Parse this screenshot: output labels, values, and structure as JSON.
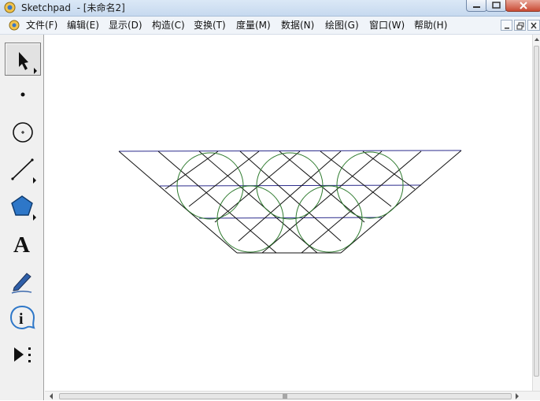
{
  "window": {
    "title": "Sketchpad  - [未命名2]"
  },
  "menu": {
    "items": [
      {
        "label": "文件(F)"
      },
      {
        "label": "编辑(E)"
      },
      {
        "label": "显示(D)"
      },
      {
        "label": "构造(C)"
      },
      {
        "label": "变换(T)"
      },
      {
        "label": "度量(M)"
      },
      {
        "label": "数据(N)"
      },
      {
        "label": "绘图(G)"
      },
      {
        "label": "窗口(W)"
      },
      {
        "label": "帮助(H)"
      }
    ]
  },
  "toolbox": {
    "tools": [
      {
        "name": "arrow-tool",
        "icon": "arrow-select-icon",
        "selected": true
      },
      {
        "name": "point-tool",
        "icon": "point-icon"
      },
      {
        "name": "compass-tool",
        "icon": "circle-icon"
      },
      {
        "name": "straightedge-tool",
        "icon": "segment-icon"
      },
      {
        "name": "polygon-tool",
        "icon": "pentagon-icon"
      },
      {
        "name": "text-tool",
        "icon": "text-A-icon",
        "glyph": "A"
      },
      {
        "name": "marker-tool",
        "icon": "marker-pen-icon"
      },
      {
        "name": "information-tool",
        "icon": "info-icon",
        "glyph": "i"
      },
      {
        "name": "custom-tool",
        "icon": "custom-tool-icon"
      }
    ]
  },
  "colors": {
    "trapezoid_line": "#000000",
    "horizontal_line": "#2b2b8c",
    "circle": "#2d7a2d"
  }
}
